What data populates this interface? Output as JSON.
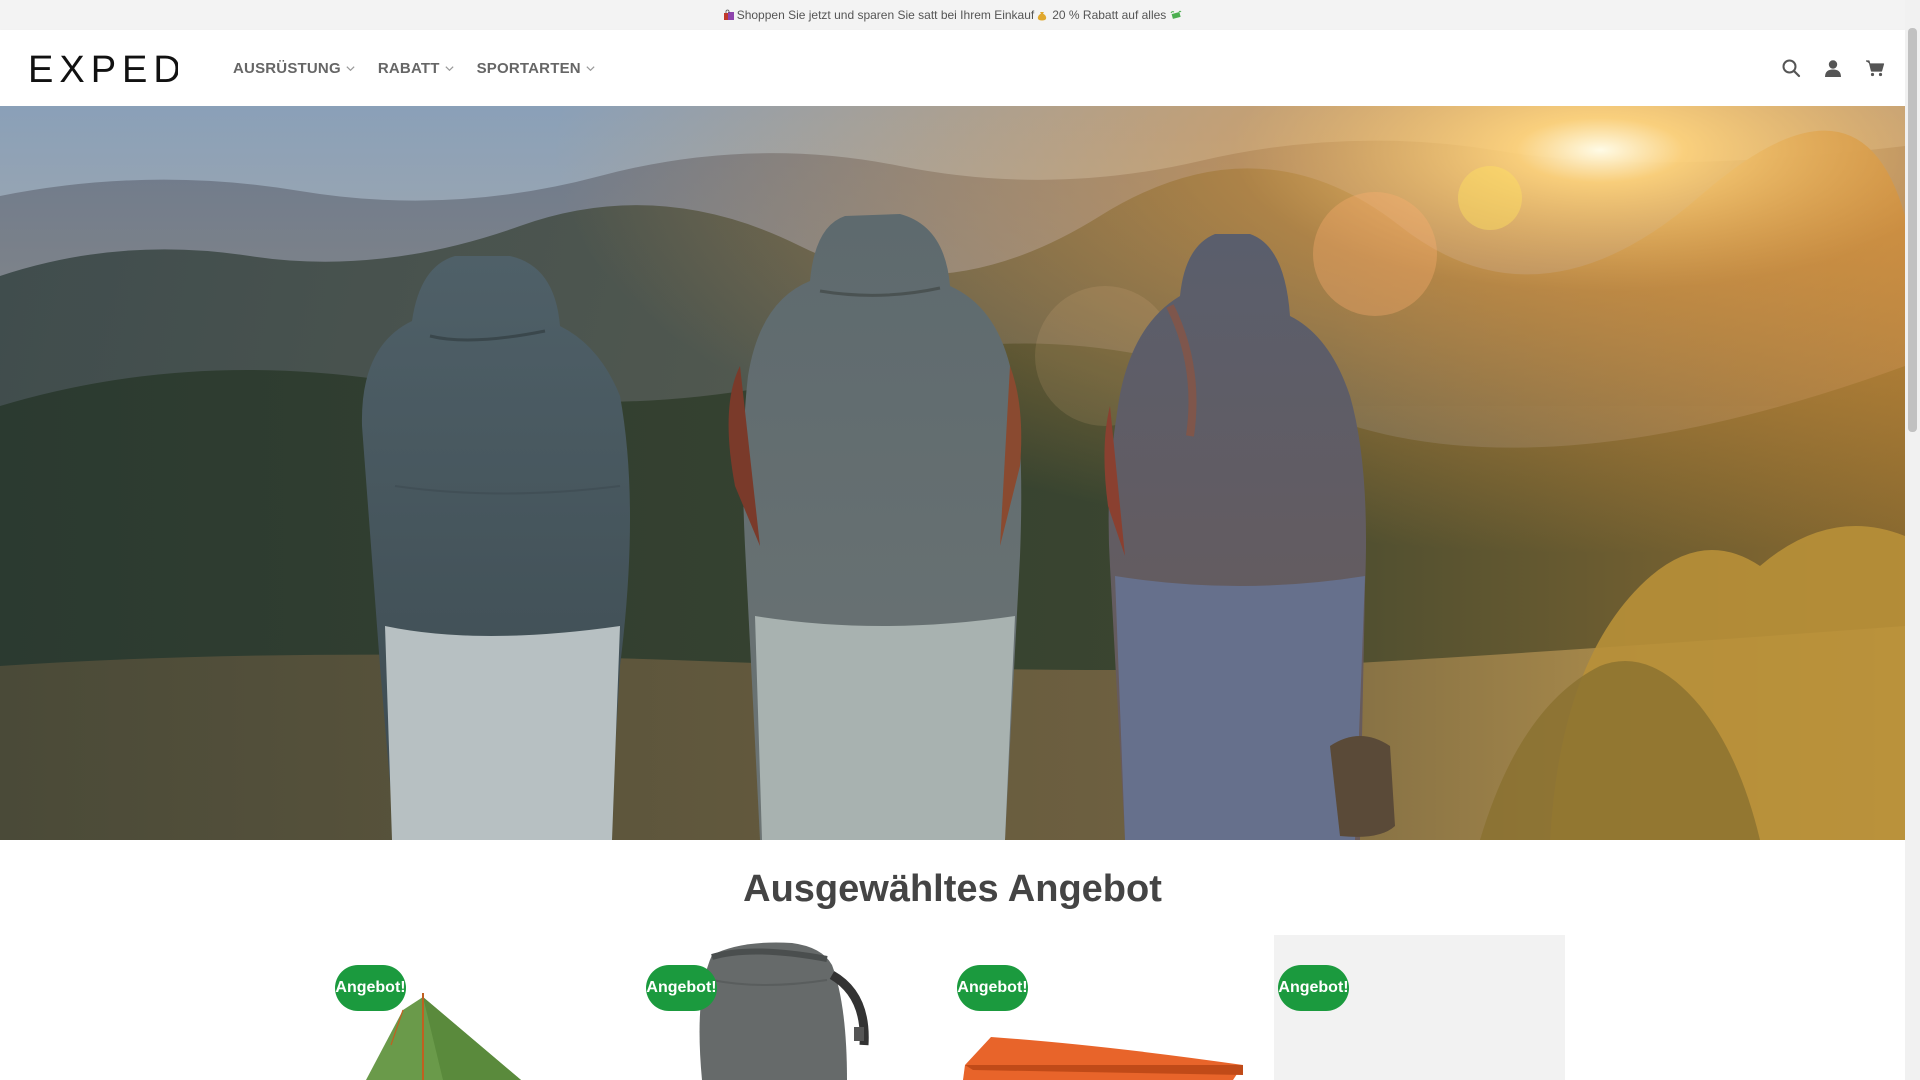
{
  "promo_bar": {
    "text": "Shoppen Sie jetzt und sparen Sie satt bei Ihrem Einkauf",
    "text2": "20 % Rabatt auf alles",
    "icons": [
      "shopping-bags-icon",
      "money-bag-icon",
      "flying-money-icon"
    ]
  },
  "header": {
    "logo_text": "EXPED",
    "nav": [
      {
        "label": "AUSRÜSTUNG"
      },
      {
        "label": "RABATT"
      },
      {
        "label": "SPORTARTEN"
      }
    ],
    "icons": [
      "search-icon",
      "account-icon",
      "cart-icon"
    ]
  },
  "hero": {
    "slides_total": 2,
    "active_slide": 1
  },
  "featured": {
    "title": "Ausgewähltes Angebot",
    "products": [
      {
        "badge": "Angebot!",
        "image": "green-tarp-tent"
      },
      {
        "badge": "Angebot!",
        "image": "grey-dry-backpack"
      },
      {
        "badge": "Angebot!",
        "image": "orange-sleeping-pad"
      },
      {
        "badge": "Angebot!",
        "image": "grey-placeholder"
      }
    ]
  },
  "colors": {
    "badge_green": "#1b9a3e",
    "nav_text": "#666666",
    "topbar_bg": "#f3f3f3"
  }
}
